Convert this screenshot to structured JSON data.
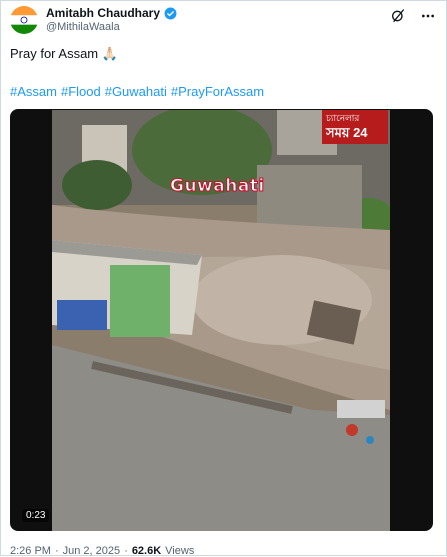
{
  "author": {
    "name": "Amitabh Chaudhary",
    "handle": "@MithilaWaala",
    "verified_icon": "verified-badge-icon",
    "avatar_icon": "india-flag-avatar"
  },
  "header_actions": [
    "grok-icon",
    "more-icon"
  ],
  "tweet": {
    "text": "Pray for Assam 🙏🏻",
    "hashtags": [
      "#Assam",
      "#Flood",
      "#Guwahati",
      "#PrayForAssam"
    ]
  },
  "media": {
    "overlay_label": "Guwahati",
    "channel_logo_line1": "চ্যানেলার",
    "channel_logo_line2": "সময় 24",
    "timecode": "0:23"
  },
  "meta": {
    "time": "2:26 PM",
    "separator": "·",
    "date": "Jun 2, 2025",
    "views_count": "62.6K",
    "views_label": "Views"
  },
  "colors": {
    "link": "#1d9bf0",
    "secondary_text": "#536471",
    "verified": "#1d9bf0"
  }
}
